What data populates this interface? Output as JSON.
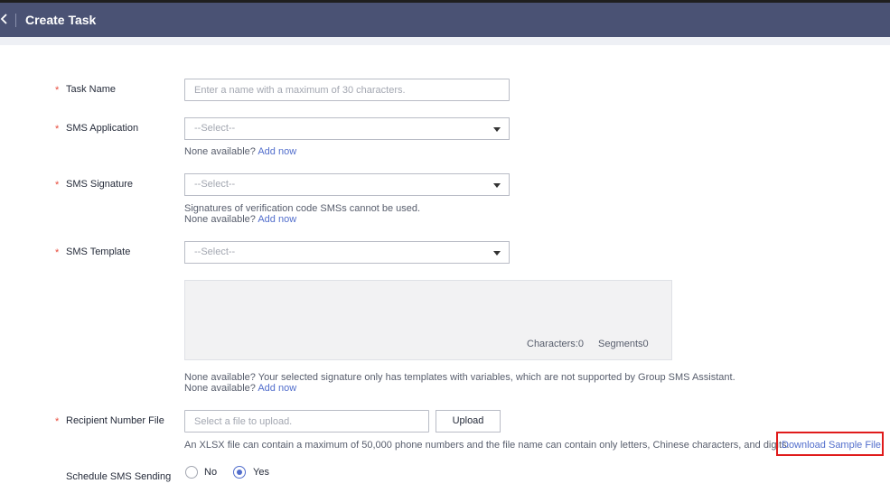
{
  "header": {
    "title": "Create Task"
  },
  "form": {
    "task_name": {
      "label": "Task Name",
      "placeholder": "Enter a name with a maximum of 30 characters.",
      "value": ""
    },
    "sms_application": {
      "label": "SMS Application",
      "value": "--Select--",
      "hint_prefix": "None available?",
      "hint_link": "Add now"
    },
    "sms_signature": {
      "label": "SMS Signature",
      "value": "--Select--",
      "hint_line1": "Signatures of verification code SMSs cannot be used.",
      "hint_prefix": "None available?",
      "hint_link": "Add now"
    },
    "sms_template": {
      "label": "SMS Template",
      "value": "--Select--",
      "characters_label": "Characters:0",
      "segments_label": "Segments0",
      "hint_line1": "None available? Your selected signature only has templates with variables, which are not supported by Group SMS Assistant.",
      "hint_prefix": "None available?",
      "hint_link": "Add now"
    },
    "recipient_file": {
      "label": "Recipient Number File",
      "placeholder": "Select a file to upload.",
      "upload_label": "Upload",
      "hint": "An XLSX file can contain a maximum of 50,000 phone numbers and the file name can contain only letters, Chinese characters, and digits.",
      "download_link": "Download Sample File"
    },
    "schedule": {
      "label": "Schedule SMS Sending",
      "options": [
        "No",
        "Yes"
      ],
      "selected": "Yes"
    },
    "required_marker": "*"
  },
  "colors": {
    "header_bg": "#4a5274",
    "link": "#526ecc",
    "required": "#e84c3d",
    "highlight": "#e01b1b"
  },
  "icons": {
    "back": "chevron-left-icon",
    "dropdown": "caret-down-icon"
  }
}
